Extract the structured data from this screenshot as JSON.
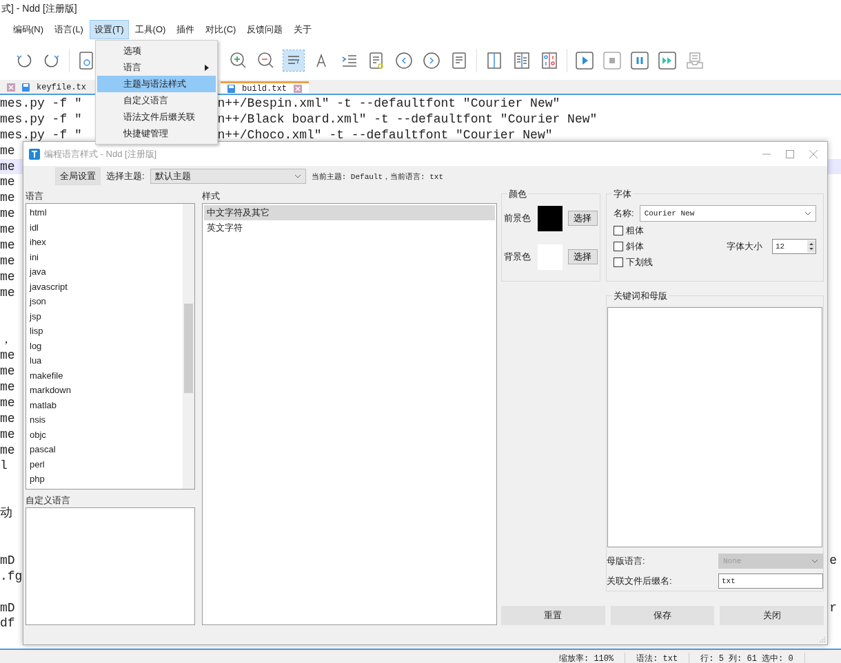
{
  "window": {
    "title": "式] - Ndd [注册版]"
  },
  "menu_bar": [
    {
      "label": "编码(N)",
      "selected": false
    },
    {
      "label": "语言(L)",
      "selected": false
    },
    {
      "label": "设置(T)",
      "selected": true
    },
    {
      "label": "工具(O)",
      "selected": false
    },
    {
      "label": "插件",
      "selected": false
    },
    {
      "label": "对比(C)",
      "selected": false
    },
    {
      "label": "反馈问题",
      "selected": false
    },
    {
      "label": "关于",
      "selected": false
    }
  ],
  "menu": [
    {
      "label": "选项",
      "selected": false
    },
    {
      "label": "语言",
      "selected": false,
      "submenu": true
    },
    {
      "label": "主题与语法样式",
      "selected": true
    },
    {
      "label": "自定义语言",
      "selected": false
    },
    {
      "label": "语法文件后缀关联",
      "selected": false
    },
    {
      "label": "快捷键管理",
      "selected": false
    }
  ],
  "toolbar": {
    "word_wrap_on": true
  },
  "tabs": [
    {
      "label": "keyfile.tx",
      "selected": false
    },
    {
      "label": "build.txt",
      "selected": true
    }
  ],
  "editor_lines": [
    {
      "left": "mes.py -f \"",
      "right": "n++/Bespin.xml\" -t --defaultfont \"Courier New\"",
      "current": false
    },
    {
      "left": "mes.py -f \"",
      "right": "n++/Black board.xml\" -t --defaultfont \"Courier New\"",
      "current": false
    },
    {
      "left": "mes.py -f \"",
      "right": "n++/Choco.xml\" -t --defaultfont \"Courier New\"",
      "current": false
    },
    {
      "left": "me",
      "current": false
    },
    {
      "left": "me",
      "current": true
    },
    {
      "left": "me",
      "current": false
    },
    {
      "left": "me",
      "current": false
    },
    {
      "left": "me",
      "current": false
    },
    {
      "left": "me",
      "current": false
    },
    {
      "left": "me",
      "current": false
    },
    {
      "left": "me",
      "current": false
    },
    {
      "left": "me",
      "current": false
    },
    {
      "left": "me",
      "current": false
    },
    {
      "current": false
    },
    {
      "current": false
    },
    {
      "left": "，",
      "current": false
    },
    {
      "left": "me",
      "current": false
    },
    {
      "left": "me",
      "current": false
    },
    {
      "left": "me",
      "current": false
    },
    {
      "left": "me",
      "current": false
    },
    {
      "left": "me",
      "current": false
    },
    {
      "left": "me",
      "current": false
    },
    {
      "left": "me",
      "current": false
    },
    {
      "left": "l",
      "current": false
    },
    {
      "current": false
    },
    {
      "current": false
    },
    {
      "left": "动",
      "current": false
    },
    {
      "current": false
    },
    {
      "current": false
    },
    {
      "left": "mD",
      "far": "e",
      "current": false
    },
    {
      "left": ".fg",
      "current": false
    },
    {
      "current": false
    },
    {
      "left": "mD",
      "far": "r",
      "current": false
    },
    {
      "left": "df",
      "current": false
    }
  ],
  "status_bar": [
    "缩放率: 110%",
    "语法: txt",
    "行: 5 列: 61 选中: 0"
  ],
  "dialog": {
    "title": "编程语言样式 - Ndd [注册版]",
    "global_button": "全局设置",
    "theme_label": "选择主题:",
    "theme_value": "默认主题",
    "current_info": "当前主题: Default，当前语言: txt",
    "languages_label": "语言",
    "languages": [
      {
        "label": "html",
        "selected": false
      },
      {
        "label": "idl",
        "selected": false
      },
      {
        "label": "ihex",
        "selected": false
      },
      {
        "label": "ini",
        "selected": false
      },
      {
        "label": "java",
        "selected": false
      },
      {
        "label": "javascript",
        "selected": false
      },
      {
        "label": "json",
        "selected": false
      },
      {
        "label": "jsp",
        "selected": false
      },
      {
        "label": "lisp",
        "selected": false
      },
      {
        "label": "log",
        "selected": false
      },
      {
        "label": "lua",
        "selected": false
      },
      {
        "label": "makefile",
        "selected": false
      },
      {
        "label": "markdown",
        "selected": false
      },
      {
        "label": "matlab",
        "selected": false
      },
      {
        "label": "nsis",
        "selected": false
      },
      {
        "label": "objc",
        "selected": false
      },
      {
        "label": "pascal",
        "selected": false
      },
      {
        "label": "perl",
        "selected": false
      },
      {
        "label": "php",
        "selected": false
      }
    ],
    "custom_label": "自定义语言",
    "styles_label": "样式",
    "styles": [
      {
        "label": "中文字符及其它",
        "selected": true
      },
      {
        "label": "英文字符",
        "selected": false
      }
    ],
    "color_group": "颜色",
    "colors": [
      {
        "label": "前景色",
        "color": "#000000",
        "button": "选择"
      },
      {
        "label": "背景色",
        "color": "#ffffff",
        "button": "选择"
      }
    ],
    "font_group": "字体",
    "font_name_label": "名称:",
    "font_name": "Courier New",
    "styles_checks": [
      {
        "label": "粗体",
        "checked": false
      },
      {
        "label": "斜体",
        "checked": false
      },
      {
        "label": "下划线",
        "checked": false
      }
    ],
    "size_label": "字体大小",
    "size": "12",
    "keyword_group": "关键词和母版",
    "parent_label": "母版语言:",
    "parent_value": "None",
    "parent_disabled": true,
    "ext_label": "关联文件后缀名:",
    "ext_value": "txt",
    "buttons": [
      "重置",
      "保存",
      "关闭"
    ]
  }
}
